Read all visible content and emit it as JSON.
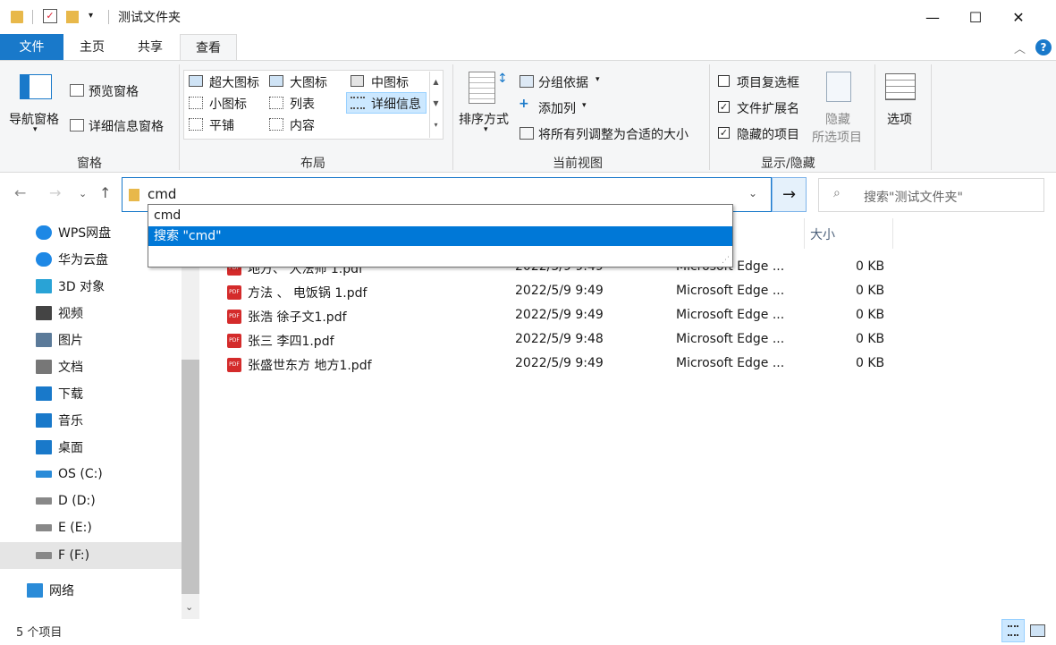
{
  "window": {
    "title": "测试文件夹",
    "minimize": "—",
    "maximize": "☐",
    "close": "✕"
  },
  "tabs": {
    "file": "文件",
    "home": "主页",
    "share": "共享",
    "view": "查看"
  },
  "ribbon": {
    "pane": {
      "nav_pane": "导航窗格",
      "preview_pane": "预览窗格",
      "details_pane": "详细信息窗格",
      "group": "窗格"
    },
    "layout": {
      "extra_large": "超大图标",
      "large": "大图标",
      "medium": "中图标",
      "small": "小图标",
      "list": "列表",
      "details": "详细信息",
      "tiles": "平铺",
      "content": "内容",
      "group": "布局"
    },
    "current_view": {
      "sort_by": "排序方式",
      "group_by": "分组依据",
      "add_column": "添加列",
      "size_all": "将所有列调整为合适的大小",
      "group": "当前视图"
    },
    "show_hide": {
      "item_checkboxes": "项目复选框",
      "file_ext": "文件扩展名",
      "hidden_items": "隐藏的项目",
      "hide": "隐藏",
      "hide_selected": "所选项目",
      "group": "显示/隐藏",
      "item_checkboxes_checked": false,
      "file_ext_checked": true,
      "hidden_items_checked": true
    },
    "options": "选项"
  },
  "address": {
    "value": "cmd",
    "search_placeholder": "搜索\"测试文件夹\""
  },
  "autocomplete": {
    "items": [
      "cmd",
      "搜索 \"cmd\""
    ],
    "selected_index": 1
  },
  "nav_pane": {
    "items": [
      "WPS网盘",
      "华为云盘",
      "3D 对象",
      "视频",
      "图片",
      "文档",
      "下载",
      "音乐",
      "桌面",
      "OS (C:)",
      "D (D:)",
      "E (E:)",
      "F (F:)",
      "网络"
    ],
    "selected": "F (F:)"
  },
  "columns": {
    "size": "大小"
  },
  "files": [
    {
      "name": "地方、 大法师 1.pdf",
      "date": "2022/5/9 9:49",
      "type": "Microsoft Edge ...",
      "size": "0 KB"
    },
    {
      "name": "方法 、 电饭锅      1.pdf",
      "date": "2022/5/9 9:49",
      "type": "Microsoft Edge ...",
      "size": "0 KB"
    },
    {
      "name": "张浩 徐子文1.pdf",
      "date": "2022/5/9 9:49",
      "type": "Microsoft Edge ...",
      "size": "0 KB"
    },
    {
      "name": "张三 李四1.pdf",
      "date": "2022/5/9 9:48",
      "type": "Microsoft Edge ...",
      "size": "0 KB"
    },
    {
      "name": "张盛世东方 地方1.pdf",
      "date": "2022/5/9 9:49",
      "type": "Microsoft Edge ...",
      "size": "0 KB"
    }
  ],
  "status": {
    "count": "5 个项目"
  },
  "colors": {
    "accent": "#1979ca",
    "selection": "#0078d7"
  }
}
